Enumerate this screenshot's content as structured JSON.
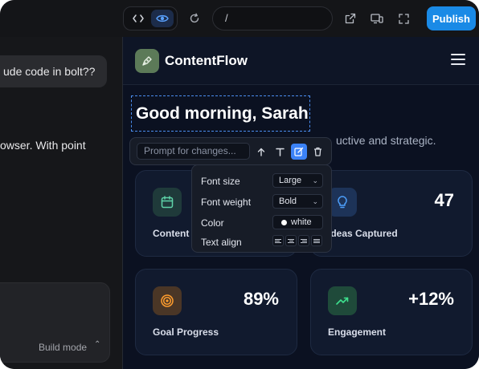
{
  "toolbar": {
    "code_icon": "code-brackets-icon",
    "preview_icon": "eye-icon",
    "refresh_icon": "refresh-icon",
    "url": "/",
    "external_icon": "open-external-icon",
    "devices_icon": "responsive-devices-icon",
    "fullscreen_icon": "fullscreen-icon",
    "publish_label": "Publish",
    "accent_color": "#1a8ae6"
  },
  "chat": {
    "user_message": "ude code in bolt??",
    "assistant_text": "owser. With point",
    "build_mode_label": "Build mode"
  },
  "app": {
    "brand": "ContentFlow",
    "greeting": "Good morning, Sarah",
    "subtitle": "uctive and strategic.",
    "cards": [
      {
        "label": "Content I",
        "value": "",
        "icon": "calendar-icon",
        "color": "#2f3f49"
      },
      {
        "label": "Ideas Captured",
        "value": "47",
        "icon": "lightbulb-icon",
        "color": "#1d3358"
      },
      {
        "label": "Goal Progress",
        "value": "89%",
        "icon": "target-icon",
        "color": "#4a3626"
      },
      {
        "label": "Engagement",
        "value": "+12%",
        "icon": "trending-up-icon",
        "color": "#1f4a3a"
      }
    ]
  },
  "editor": {
    "prompt_placeholder": "Prompt for changes...",
    "font_size_label": "Font size",
    "font_size_value": "Large",
    "font_weight_label": "Font weight",
    "font_weight_value": "Bold",
    "color_label": "Color",
    "color_value": "white",
    "text_align_label": "Text align"
  }
}
